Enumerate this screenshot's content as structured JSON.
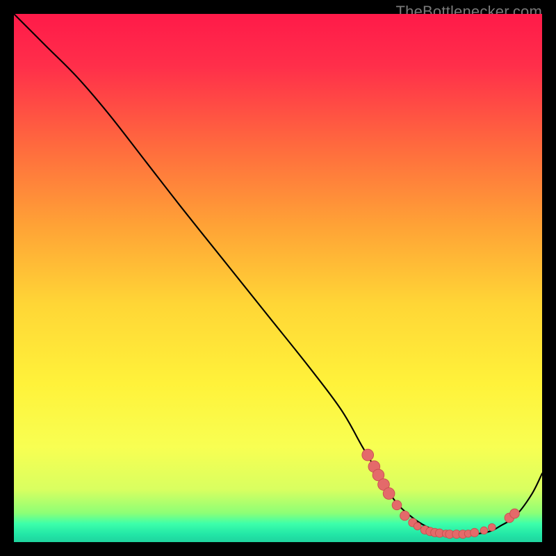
{
  "watermark": "TheBottlenecker.com",
  "colors": {
    "black": "#000000",
    "curve": "#000000",
    "dot_fill": "#e46a6a",
    "dot_stroke": "#c94f4f",
    "gradient_stops": [
      {
        "offset": 0.0,
        "color": "#ff1a49"
      },
      {
        "offset": 0.1,
        "color": "#ff2f4a"
      },
      {
        "offset": 0.25,
        "color": "#ff6a3e"
      },
      {
        "offset": 0.4,
        "color": "#ffa236"
      },
      {
        "offset": 0.55,
        "color": "#ffd636"
      },
      {
        "offset": 0.7,
        "color": "#fff23a"
      },
      {
        "offset": 0.82,
        "color": "#f8ff52"
      },
      {
        "offset": 0.9,
        "color": "#d9ff60"
      },
      {
        "offset": 0.945,
        "color": "#8dff76"
      },
      {
        "offset": 0.965,
        "color": "#3dffaa"
      },
      {
        "offset": 0.985,
        "color": "#22e7a7"
      },
      {
        "offset": 1.0,
        "color": "#1fd39e"
      }
    ]
  },
  "chart_data": {
    "type": "line",
    "title": "",
    "xlabel": "",
    "ylabel": "",
    "xlim": [
      0,
      100
    ],
    "ylim": [
      0,
      100
    ],
    "grid": false,
    "legend": "none",
    "series": [
      {
        "name": "curve",
        "x": [
          0,
          6,
          12,
          18,
          25,
          32,
          40,
          48,
          56,
          62,
          66,
          69,
          72,
          75,
          78,
          81,
          84,
          87,
          90,
          92,
          95,
          98,
          100
        ],
        "y": [
          100,
          94,
          88,
          81,
          72,
          63,
          53,
          43,
          33,
          25,
          18,
          13,
          8,
          5,
          3,
          2,
          1.5,
          1.5,
          2,
          3,
          5,
          9,
          13
        ]
      }
    ],
    "markers": [
      {
        "x": 67.0,
        "y": 16.5,
        "r": 1.1
      },
      {
        "x": 68.2,
        "y": 14.3,
        "r": 1.1
      },
      {
        "x": 69.0,
        "y": 12.7,
        "r": 1.1
      },
      {
        "x": 70.0,
        "y": 10.9,
        "r": 1.1
      },
      {
        "x": 71.0,
        "y": 9.2,
        "r": 1.1
      },
      {
        "x": 72.5,
        "y": 7.0,
        "r": 0.9
      },
      {
        "x": 74.0,
        "y": 5.0,
        "r": 0.9
      },
      {
        "x": 75.5,
        "y": 3.7,
        "r": 0.8
      },
      {
        "x": 76.4,
        "y": 3.0,
        "r": 0.7
      },
      {
        "x": 77.8,
        "y": 2.3,
        "r": 0.8
      },
      {
        "x": 78.8,
        "y": 2.0,
        "r": 0.8
      },
      {
        "x": 79.7,
        "y": 1.8,
        "r": 0.8
      },
      {
        "x": 80.6,
        "y": 1.7,
        "r": 0.8
      },
      {
        "x": 81.8,
        "y": 1.6,
        "r": 0.7
      },
      {
        "x": 82.5,
        "y": 1.5,
        "r": 0.8
      },
      {
        "x": 83.8,
        "y": 1.5,
        "r": 0.8
      },
      {
        "x": 85.0,
        "y": 1.5,
        "r": 0.8
      },
      {
        "x": 86.0,
        "y": 1.6,
        "r": 0.7
      },
      {
        "x": 87.2,
        "y": 1.8,
        "r": 0.8
      },
      {
        "x": 89.0,
        "y": 2.2,
        "r": 0.7
      },
      {
        "x": 90.5,
        "y": 2.8,
        "r": 0.7
      },
      {
        "x": 93.8,
        "y": 4.6,
        "r": 0.9
      },
      {
        "x": 94.8,
        "y": 5.4,
        "r": 0.9
      }
    ]
  }
}
